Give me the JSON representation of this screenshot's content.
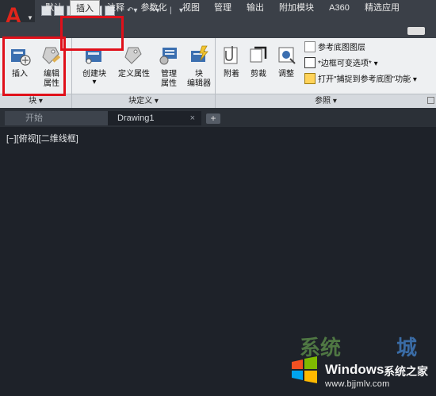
{
  "quick_access": {
    "overflow_arrow": "▾"
  },
  "tabs": [
    {
      "label": "默认"
    },
    {
      "label": "插入"
    },
    {
      "label": "注释"
    },
    {
      "label": "参数化"
    },
    {
      "label": "视图"
    },
    {
      "label": "管理"
    },
    {
      "label": "输出"
    },
    {
      "label": "附加模块"
    },
    {
      "label": "A360"
    },
    {
      "label": "精选应用"
    }
  ],
  "ribbon": {
    "block_panel": {
      "title": "块",
      "insert_label": "插入",
      "edit_attr_label_1": "编辑",
      "edit_attr_label_2": "属性"
    },
    "block_def_panel": {
      "title": "块定义",
      "create_block_label": "创建块",
      "define_attr_label": "定义属性",
      "manage_attr_label_1": "管理",
      "manage_attr_label_2": "属性",
      "block_editor_label_1": "块",
      "block_editor_label_2": "编辑器"
    },
    "reference_panel": {
      "title": "参照",
      "attach_label": "附着",
      "clip_label": "剪裁",
      "adjust_label": "调整",
      "underlay_layers": "参考底图图层",
      "frame_variable": "*边框可变选项*",
      "snap_underlay": "打开\"捕捉到参考底图\"功能"
    }
  },
  "file_tabs": {
    "start": "开始",
    "drawing": "Drawing1",
    "close": "×",
    "add": "+"
  },
  "viewport": {
    "label": "[−][俯视][二维线框]"
  },
  "watermark": {
    "brand": "Windows",
    "brand_cn": "系统之家",
    "url": "www.bjjmlv.com",
    "overlay_text_1": "系统",
    "overlay_text_2": "城"
  },
  "colors": {
    "highlight": "#e0101a",
    "canvas": "#1e2229",
    "ribbon": "#eef0f2"
  }
}
